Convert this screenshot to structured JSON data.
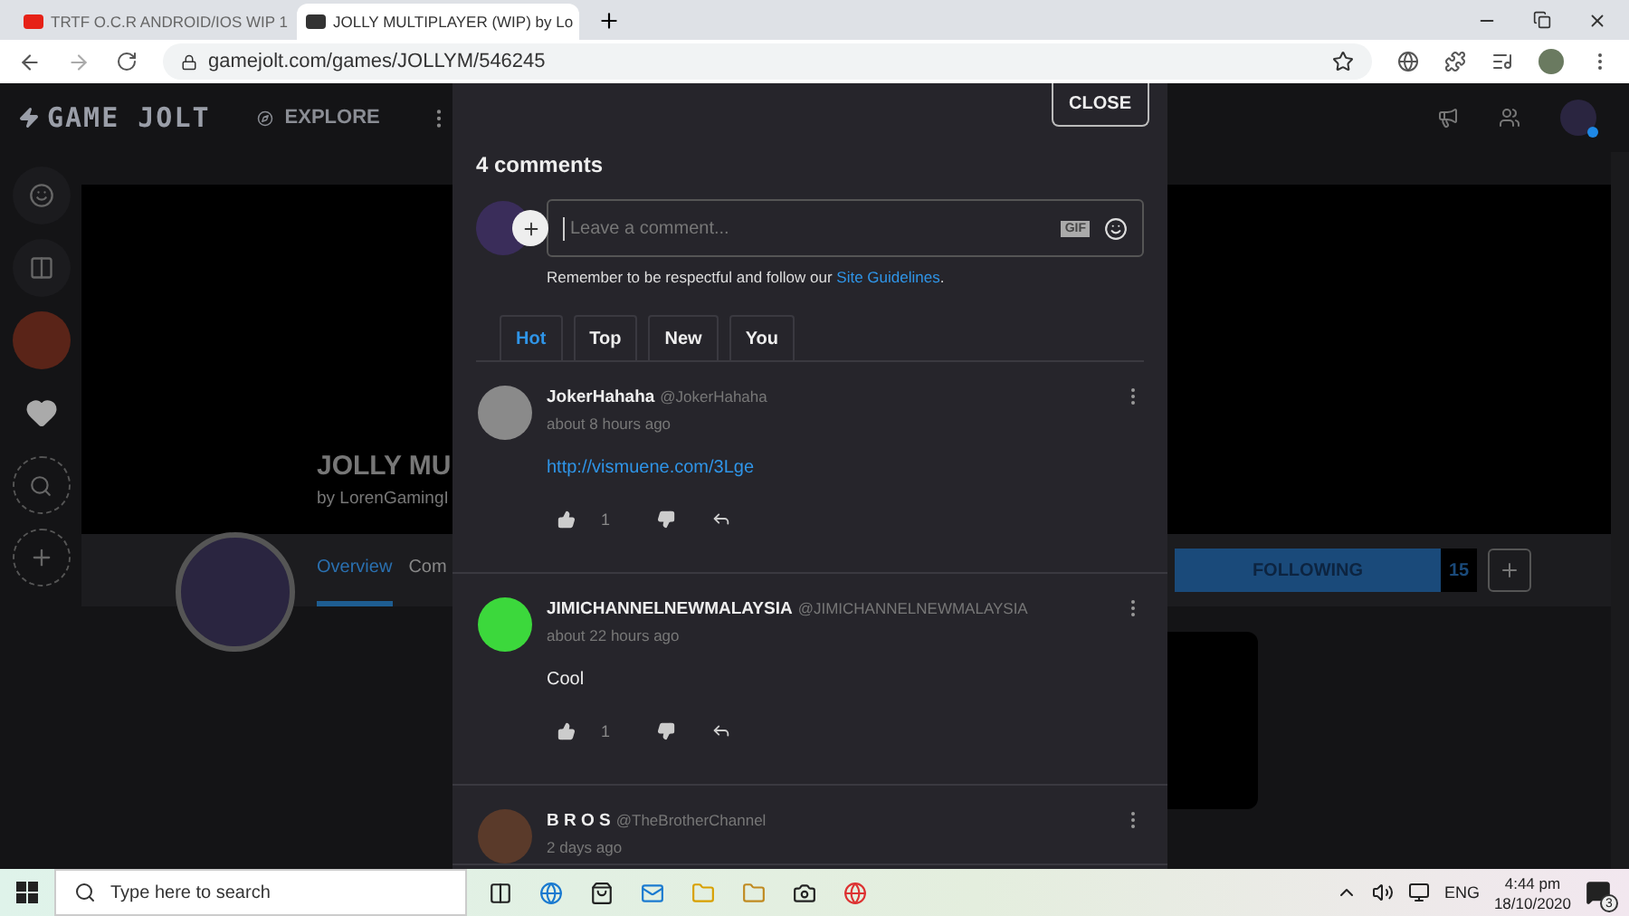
{
  "browser": {
    "tabs": [
      {
        "title": "TRTF O.C.R ANDROID/IOS WIP 1",
        "selected": false
      },
      {
        "title": "JOLLY MULTIPLAYER (WIP) by Lo",
        "selected": true
      }
    ],
    "url": "gamejolt.com/games/JOLLYM/546245"
  },
  "site_nav": {
    "logo": "GAME JOLT",
    "explore": "EXPLORE"
  },
  "game": {
    "title": "JOLLY MU",
    "author": "by LorenGamingI",
    "tabs": [
      {
        "label": "Overview",
        "selected": true
      },
      {
        "label": "Com",
        "selected": false
      }
    ],
    "follow_label": "FOLLOWING",
    "follow_count": "15",
    "following": true
  },
  "comments_modal": {
    "close": "CLOSE",
    "heading": "4 comments",
    "placeholder": "Leave a comment...",
    "gif": "GIF",
    "guidelines": "Remember to be respectful and follow our ",
    "guidelines_link": "Site Guidelines",
    "guidelines_end": ".",
    "sort_tabs": [
      {
        "label": "Hot",
        "selected": true
      },
      {
        "label": "Top",
        "selected": false
      },
      {
        "label": "New",
        "selected": false
      },
      {
        "label": "You",
        "selected": false
      }
    ],
    "comments": [
      {
        "name": "JokerHahaha",
        "handle": "@JokerHahaha",
        "time": "about 8 hours ago",
        "body": {
          "kind": "link",
          "text": "http://vismuene.com/3Lge"
        },
        "likes": "1"
      },
      {
        "name": "JIMICHANNELNEWMALAYSIA",
        "handle": "@JIMICHANNELNEWMALAYSIA",
        "time": "about 22 hours ago",
        "body": {
          "kind": "text",
          "text": "Cool"
        },
        "likes": "1"
      },
      {
        "name": "B R O S",
        "handle": "@TheBrotherChannel",
        "time": "2 days ago"
      }
    ]
  },
  "taskbar": {
    "search_placeholder": "Type here to search",
    "language": "ENG",
    "time": "4:44 pm",
    "date": "18/10/2020",
    "notifications": "3"
  }
}
